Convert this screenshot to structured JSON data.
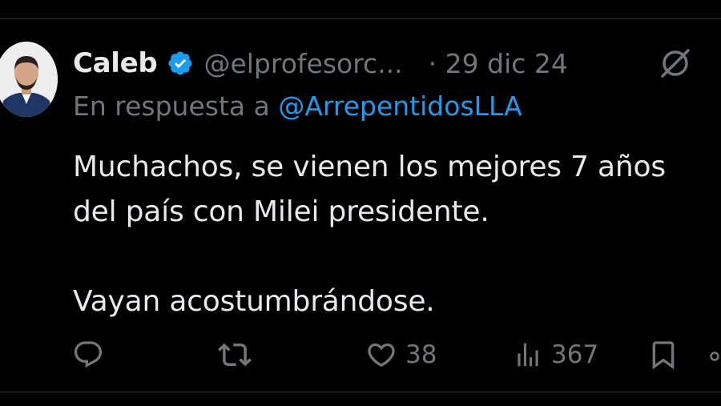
{
  "tweet": {
    "author": {
      "display_name": "Caleb",
      "handle": "@elprofesorc...",
      "verified": true,
      "avatar_icon": "profile-photo"
    },
    "date": "· 29 dic 24",
    "reply_prefix": "En respuesta a",
    "reply_to": "@ArrepentidosLLA",
    "text_paragraphs": [
      "Muchachos, se vienen los mejores 7 años del país con Milei presidente.",
      "Vayan acostumbrándose."
    ]
  },
  "actions": {
    "reply": {
      "icon": "reply-icon",
      "count": ""
    },
    "retweet": {
      "icon": "retweet-icon",
      "count": ""
    },
    "like": {
      "icon": "heart-icon",
      "count": "38"
    },
    "views": {
      "icon": "views-icon",
      "count": "367"
    },
    "bookmark": {
      "icon": "bookmark-icon",
      "count": ""
    },
    "share": {
      "icon": "share-icon"
    }
  },
  "colors": {
    "background": "#000000",
    "text_primary": "#e7e9ea",
    "text_secondary": "#71767b",
    "accent": "#1d9bf0"
  }
}
